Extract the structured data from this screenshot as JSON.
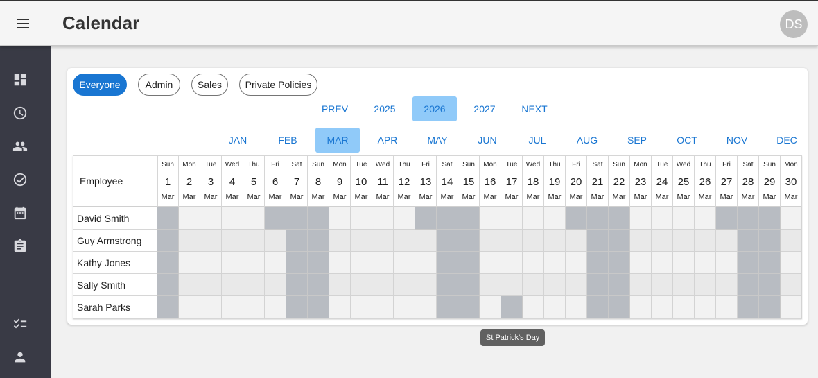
{
  "header": {
    "title": "Calendar",
    "avatar_initials": "DS"
  },
  "sidebar": {
    "top_icons": [
      "dashboard-icon",
      "clock-icon",
      "people-icon",
      "check-circle-icon",
      "calendar-icon",
      "clipboard-icon"
    ],
    "bottom_icons": [
      "checklist-icon",
      "person-icon"
    ]
  },
  "filters": {
    "chips": [
      {
        "label": "Everyone",
        "active": true
      },
      {
        "label": "Admin",
        "active": false
      },
      {
        "label": "Sales",
        "active": false
      },
      {
        "label": "Private Policies",
        "active": false
      }
    ]
  },
  "year_nav": {
    "prev": "PREV",
    "years": [
      "2025",
      "2026",
      "2027"
    ],
    "selected_year": "2026",
    "next": "NEXT"
  },
  "months": {
    "labels": [
      "JAN",
      "FEB",
      "MAR",
      "APR",
      "MAY",
      "JUN",
      "JUL",
      "AUG",
      "SEP",
      "OCT",
      "NOV",
      "DEC"
    ],
    "selected": "MAR"
  },
  "grid": {
    "employee_header": "Employee",
    "month_abbr": "Mar",
    "days": [
      {
        "name": "Sun",
        "date": "1"
      },
      {
        "name": "Mon",
        "date": "2"
      },
      {
        "name": "Tue",
        "date": "3"
      },
      {
        "name": "Wed",
        "date": "4"
      },
      {
        "name": "Thu",
        "date": "5"
      },
      {
        "name": "Fri",
        "date": "6"
      },
      {
        "name": "Sat",
        "date": "7"
      },
      {
        "name": "Sun",
        "date": "8"
      },
      {
        "name": "Mon",
        "date": "9"
      },
      {
        "name": "Tue",
        "date": "10"
      },
      {
        "name": "Wed",
        "date": "11"
      },
      {
        "name": "Thu",
        "date": "12"
      },
      {
        "name": "Fri",
        "date": "13"
      },
      {
        "name": "Sat",
        "date": "14"
      },
      {
        "name": "Sun",
        "date": "15"
      },
      {
        "name": "Mon",
        "date": "16"
      },
      {
        "name": "Tue",
        "date": "17"
      },
      {
        "name": "Wed",
        "date": "18"
      },
      {
        "name": "Thu",
        "date": "19"
      },
      {
        "name": "Fri",
        "date": "20"
      },
      {
        "name": "Sat",
        "date": "21"
      },
      {
        "name": "Sun",
        "date": "22"
      },
      {
        "name": "Mon",
        "date": "23"
      },
      {
        "name": "Tue",
        "date": "24"
      },
      {
        "name": "Wed",
        "date": "25"
      },
      {
        "name": "Thu",
        "date": "26"
      },
      {
        "name": "Fri",
        "date": "27"
      },
      {
        "name": "Sat",
        "date": "28"
      },
      {
        "name": "Sun",
        "date": "29"
      },
      {
        "name": "Mon",
        "date": "30"
      }
    ],
    "employees": [
      {
        "name": "David Smith",
        "off_dates": [
          "1",
          "6",
          "7",
          "8",
          "13",
          "14",
          "15",
          "20",
          "21",
          "22",
          "27",
          "28",
          "29"
        ]
      },
      {
        "name": "Guy Armstrong",
        "off_dates": [
          "1",
          "7",
          "8",
          "14",
          "15",
          "21",
          "22",
          "28",
          "29"
        ]
      },
      {
        "name": "Kathy Jones",
        "off_dates": [
          "1",
          "7",
          "8",
          "14",
          "15",
          "21",
          "22",
          "28",
          "29"
        ]
      },
      {
        "name": "Sally Smith",
        "off_dates": [
          "1",
          "7",
          "8",
          "14",
          "15",
          "21",
          "22",
          "28",
          "29"
        ]
      },
      {
        "name": "Sarah Parks",
        "off_dates": [
          "1",
          "7",
          "8",
          "14",
          "15",
          "17",
          "21",
          "22",
          "28",
          "29"
        ]
      }
    ]
  },
  "tooltip": {
    "text": "St Patrick's Day"
  }
}
